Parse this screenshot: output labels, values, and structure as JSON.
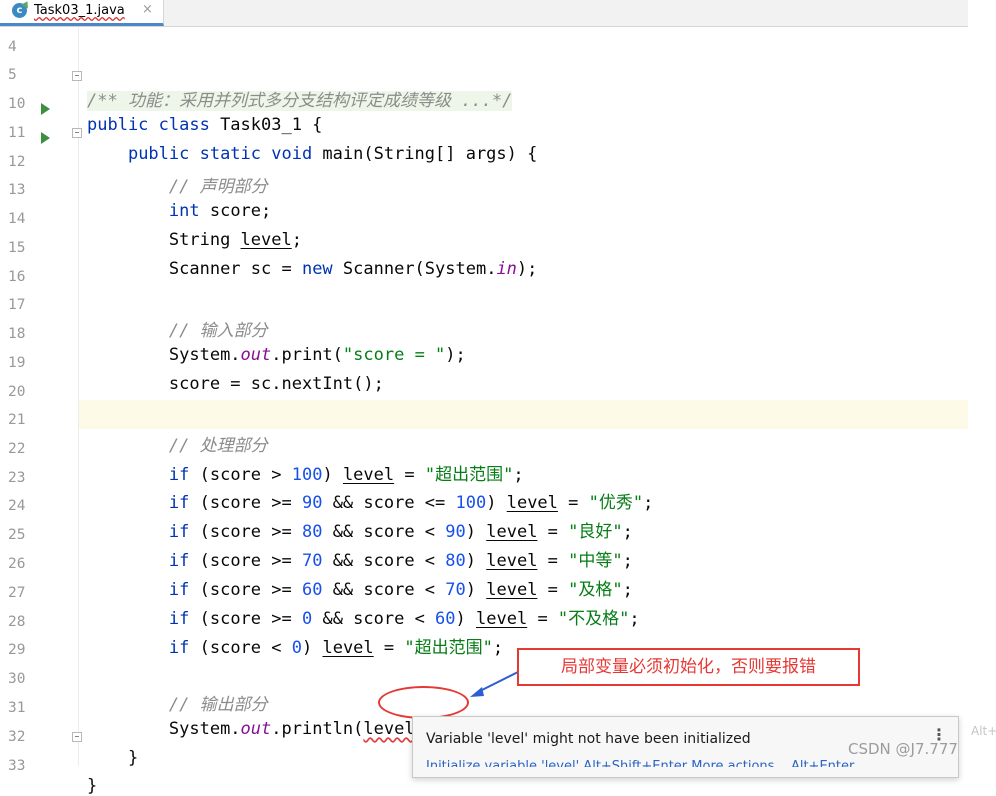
{
  "tab": {
    "icon": "java-class-icon",
    "icon_glyph": "c",
    "title": "Task03_1.java",
    "close": "×"
  },
  "lines": [
    {
      "n": "4"
    },
    {
      "n": "5"
    },
    {
      "n": "10"
    },
    {
      "n": "11"
    },
    {
      "n": "12"
    },
    {
      "n": "13"
    },
    {
      "n": "14"
    },
    {
      "n": "15"
    },
    {
      "n": "16"
    },
    {
      "n": "17"
    },
    {
      "n": "18"
    },
    {
      "n": "19"
    },
    {
      "n": "20"
    },
    {
      "n": "21"
    },
    {
      "n": "22"
    },
    {
      "n": "23"
    },
    {
      "n": "24"
    },
    {
      "n": "25"
    },
    {
      "n": "26"
    },
    {
      "n": "27"
    },
    {
      "n": "28"
    },
    {
      "n": "29"
    },
    {
      "n": "30"
    },
    {
      "n": "31"
    },
    {
      "n": "32"
    },
    {
      "n": "33"
    }
  ],
  "code": {
    "l5_doc": "/** 功能：采用并列式多分支结构评定成绩等级 ...*/",
    "l10_kw": "public class",
    "l10_rest": " Task03_1 {",
    "l11_kw": "public static void",
    "l11_rest": " main(String[] args) {",
    "l12": "// 声明部分",
    "l13_kw": "int",
    "l13_rest": " score;",
    "l14_a": "String ",
    "l14_b": "level",
    "l14_c": ";",
    "l15_a": "Scanner sc = ",
    "l15_kw": "new",
    "l15_b": " Scanner(System.",
    "l15_f": "in",
    "l15_c": ");",
    "l17": "// 输入部分",
    "l18_a": "System.",
    "l18_f": "out",
    "l18_b": ".print(",
    "l18_s": "\"score = \"",
    "l18_c": ");",
    "l19": "score = sc.nextInt();",
    "l21": "// 处理部分",
    "if": "if",
    "level": "level",
    "l22_a": " (score > ",
    "l22_n": "100",
    "l22_b": ") ",
    "l22_c": " = ",
    "l22_s": "\"超出范围\"",
    "l23_a": " (score >= ",
    "l23_n1": "90",
    "l23_b": " && score <= ",
    "l23_n2": "100",
    "l23_c": ") ",
    "l23_s": "\"优秀\"",
    "l24_a": " (score >= ",
    "l24_n1": "80",
    "l24_b": " && score < ",
    "l24_n2": "90",
    "l24_c": ") ",
    "l24_s": "\"良好\"",
    "l25_a": " (score >= ",
    "l25_n1": "70",
    "l25_b": " && score < ",
    "l25_n2": "80",
    "l25_c": ") ",
    "l25_s": "\"中等\"",
    "l26_a": " (score >= ",
    "l26_n1": "60",
    "l26_b": " && score < ",
    "l26_n2": "70",
    "l26_c": ") ",
    "l26_s": "\"及格\"",
    "l27_a": " (score >= ",
    "l27_n1": "0",
    "l27_b": " && score < ",
    "l27_n2": "60",
    "l27_c": ") ",
    "l27_s": "\"不及格\"",
    "l28_a": " (score < ",
    "l28_n": "0",
    "l28_b": ") ",
    "l28_s": "\"超出范围\"",
    "eq": " = ",
    "semi": ";",
    "l30": "// 输出部分",
    "l31_a": "System.",
    "l31_f": "out",
    "l31_b": ".println(",
    "l31_v": "level",
    "l31_c": ");",
    "l32": "}",
    "l33": "}"
  },
  "callout": {
    "text": "局部变量必须初始化，否则要报错",
    "color": "#e53935"
  },
  "tooltip": {
    "message": "Variable 'level' might not have been initialized",
    "more": "⋮",
    "fix": "Initialize variable 'level'   Alt+Shift+Enter   More actions...   Alt+Enter"
  },
  "alt_hint": "Alt+",
  "watermark": "CSDN @J7.777"
}
